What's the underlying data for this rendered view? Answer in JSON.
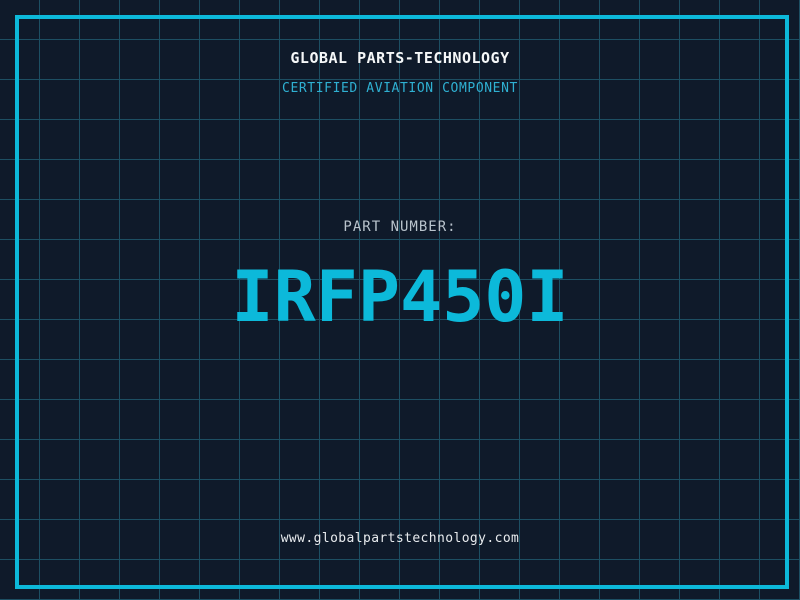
{
  "colors": {
    "background": "#0f1a2a",
    "grid_line": "#1d4f63",
    "frame_border": "#0cb9da",
    "company_text": "#f5f7f8",
    "certification_text": "#2fb0d2",
    "part_label_text": "#b9c3cc",
    "part_number_text": "#0cb9da",
    "website_text": "#e8ebee"
  },
  "header": {
    "company_name": "GLOBAL PARTS-TECHNOLOGY",
    "certification": "CERTIFIED AVIATION COMPONENT"
  },
  "part": {
    "label": "PART NUMBER:",
    "number": "IRFP450I"
  },
  "footer": {
    "website": "www.globalpartstechnology.com"
  }
}
